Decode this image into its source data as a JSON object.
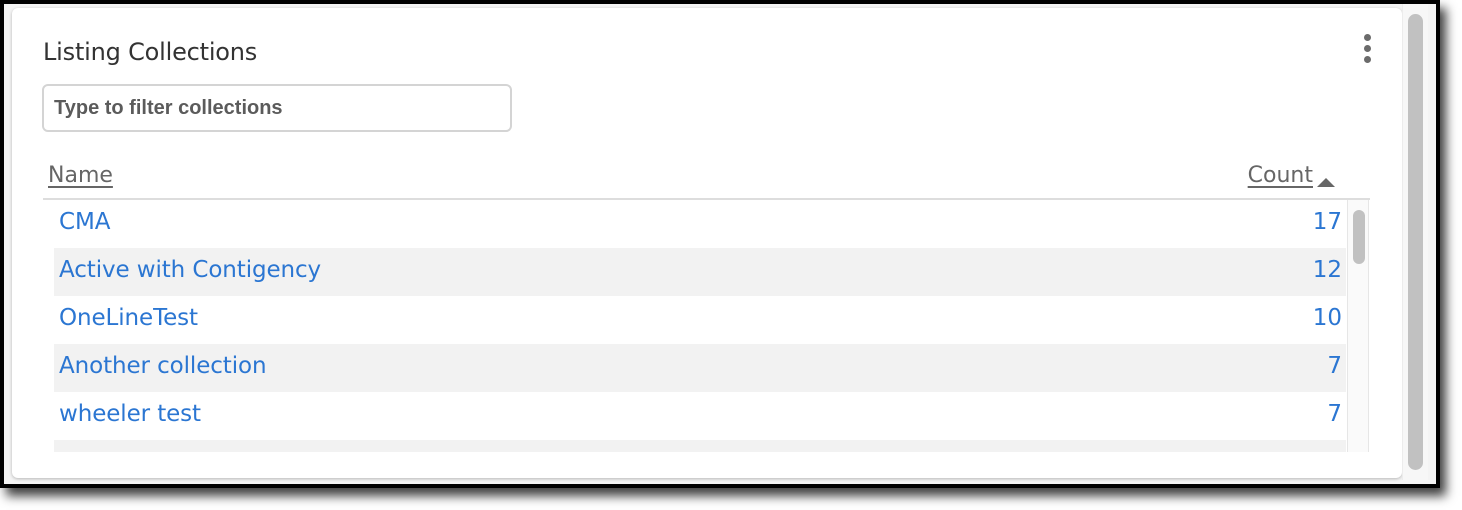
{
  "panel": {
    "title": "Listing Collections",
    "more_icon": "more-vertical-icon"
  },
  "filter": {
    "value": "",
    "placeholder": "Type to filter collections"
  },
  "table": {
    "columns": {
      "name": "Name",
      "count": "Count"
    },
    "sort": {
      "column": "Count",
      "direction": "ascending",
      "icon": "sort-up-icon"
    },
    "rows": [
      {
        "name": "CMA",
        "count": "17"
      },
      {
        "name": "Active with Contigency",
        "count": "12"
      },
      {
        "name": "OneLineTest",
        "count": "10"
      },
      {
        "name": "Another collection",
        "count": "7"
      },
      {
        "name": "wheeler test",
        "count": "7"
      },
      {
        "name": "",
        "count": ""
      }
    ]
  },
  "colors": {
    "link": "#2b76d2",
    "header_text": "#666666",
    "row_alt_bg": "#f2f2f2",
    "title_text": "#333333",
    "scrollbar_thumb": "#c1c1c1"
  }
}
